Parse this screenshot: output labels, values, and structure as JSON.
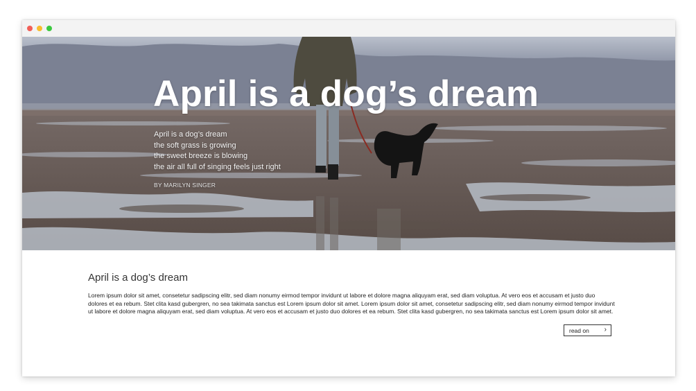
{
  "window": {
    "controls": [
      {
        "name": "close",
        "color": "#f25f57"
      },
      {
        "name": "minimize",
        "color": "#f9bd2e"
      },
      {
        "name": "maximize",
        "color": "#3cc940"
      }
    ]
  },
  "hero": {
    "title": "April is a dog’s dream",
    "poem_lines": [
      "April is a dog’s dream",
      "the soft grass is growing",
      "the sweet breeze is blowing",
      "the air all full of singing feels just right"
    ],
    "byline": "BY MARILYN SINGER",
    "image_subject": "person-walking-dog-on-wet-beach"
  },
  "article": {
    "title": "April is a dog’s dream",
    "body": "Lorem ipsum dolor sit amet, consetetur sadipscing elitr, sed diam nonumy eirmod tempor invidunt ut labore et dolore magna aliquyam erat, sed diam voluptua. At vero eos et accusam et justo duo dolores et ea rebum. Stet clita kasd gubergren, no sea takimata sanctus est Lorem ipsum dolor sit amet. Lorem ipsum dolor sit amet, consetetur sadipscing elitr, sed diam nonumy eirmod tempor invidunt ut labore et dolore magna aliquyam erat, sed diam voluptua. At vero eos et accusam et justo duo dolores et ea rebum. Stet clita kasd gubergren, no sea takimata sanctus est Lorem ipsum dolor sit amet.",
    "read_on_label": "read on",
    "read_on_icon": "chevron-right-icon"
  }
}
